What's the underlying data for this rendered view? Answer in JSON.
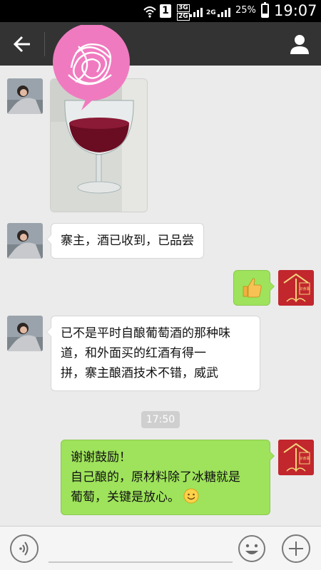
{
  "statusbar": {
    "sim_slot": "1",
    "network_a_top": "3G",
    "network_a_bottom": "2G",
    "network_b": "2G",
    "battery": "25%",
    "time": "19:07"
  },
  "navbar": {
    "back_icon": "arrow-left-icon",
    "profile_icon": "person-icon"
  },
  "messages": [
    {
      "id": 0,
      "direction": "in",
      "type": "image",
      "image_desc": "red-wine-glass-photo"
    },
    {
      "id": 1,
      "direction": "in",
      "type": "text",
      "text": "寨主，酒已收到，已品尝"
    },
    {
      "id": 2,
      "direction": "out",
      "type": "sticker",
      "sticker": "thumbs-up-icon"
    },
    {
      "id": 3,
      "direction": "in",
      "type": "text",
      "lines": [
        "已不是平时自酿葡萄酒的那种味",
        "道，和外面买的红酒有得一",
        "拼，寨主酿酒技术不错，威武"
      ]
    },
    {
      "id": 4,
      "direction": "out",
      "type": "text",
      "lines": [
        "谢谢鼓励！",
        "自己酿的，原材料除了冰糖就是",
        "葡萄，关键是放心。"
      ],
      "trailing_emoji": "smile-icon"
    }
  ],
  "timestamp": "17:50",
  "my_avatar_text": "好食寨",
  "bottombar": {
    "voice_icon": "voice-icon",
    "emoji_icon": "emoji-icon",
    "plus_icon": "plus-icon"
  },
  "colors": {
    "nav_bg": "#333334",
    "chat_bg": "#ebebeb",
    "out_bubble": "#9ee35b",
    "in_bubble": "#ffffff"
  }
}
